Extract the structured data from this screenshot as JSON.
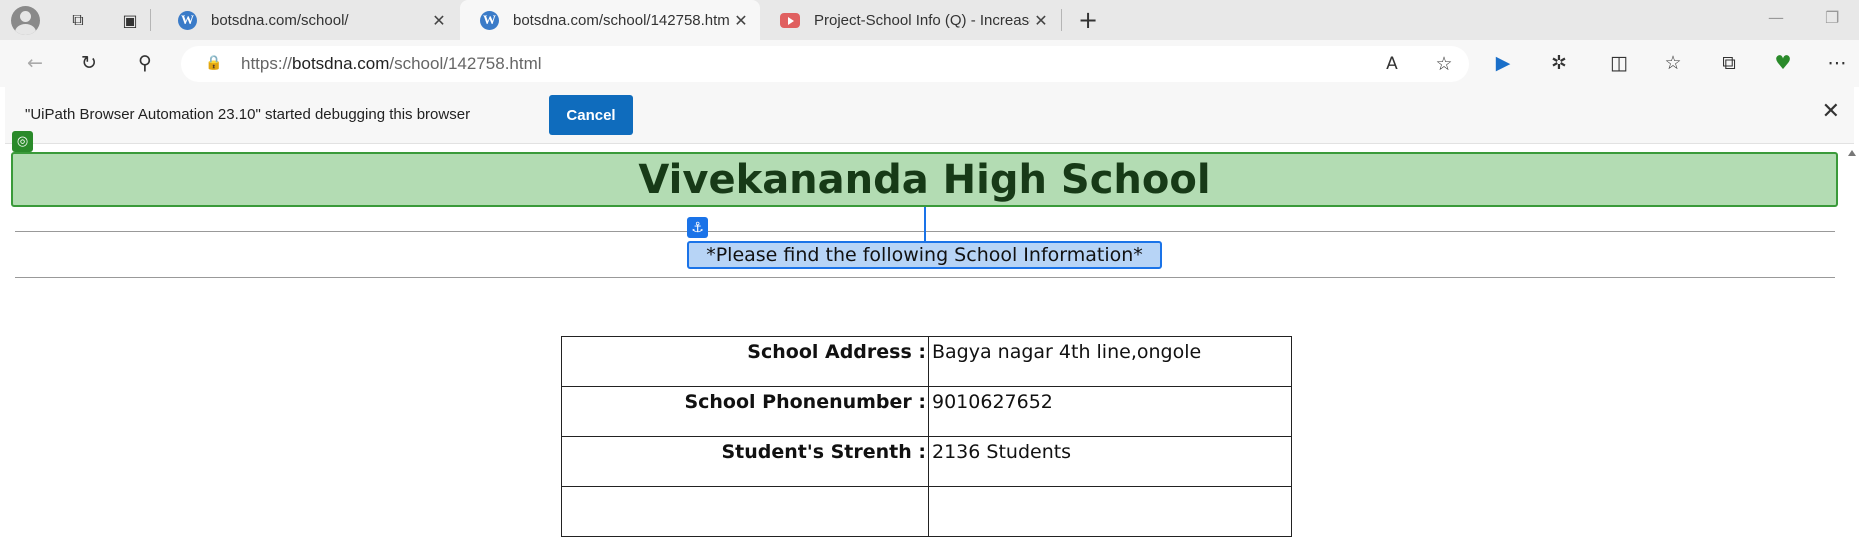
{
  "tabs": [
    {
      "label": "botsdna.com/school/",
      "icon": "wordpress-icon",
      "active": false
    },
    {
      "label": "botsdna.com/school/142758.htm",
      "icon": "wordpress-icon",
      "active": true
    },
    {
      "label": "Project-School Info (Q) - Increase",
      "icon": "youtube-icon",
      "active": false
    }
  ],
  "toolbar": {
    "url_protocol": "https://",
    "url_host": "botsdna.com",
    "url_path": "/school/142758.html"
  },
  "infobar": {
    "message": "\"UiPath Browser Automation 23.10\" started debugging this browser",
    "cancel_label": "Cancel"
  },
  "page": {
    "title": "Vivekananda High School",
    "subtitle": "*Please find the following School Information*",
    "rows": [
      {
        "label": "School Address :",
        "value": "Bagya nagar 4th line,ongole"
      },
      {
        "label": "School Phonenumber :",
        "value": "9010627652"
      },
      {
        "label": "Student's Strenth :",
        "value": "2136 Students"
      }
    ]
  },
  "colors": {
    "title_background": "#b3dcb3",
    "title_border": "#3a9a3a",
    "subtitle_highlight": "#b7d4f6",
    "accent": "#0f6cbd"
  }
}
